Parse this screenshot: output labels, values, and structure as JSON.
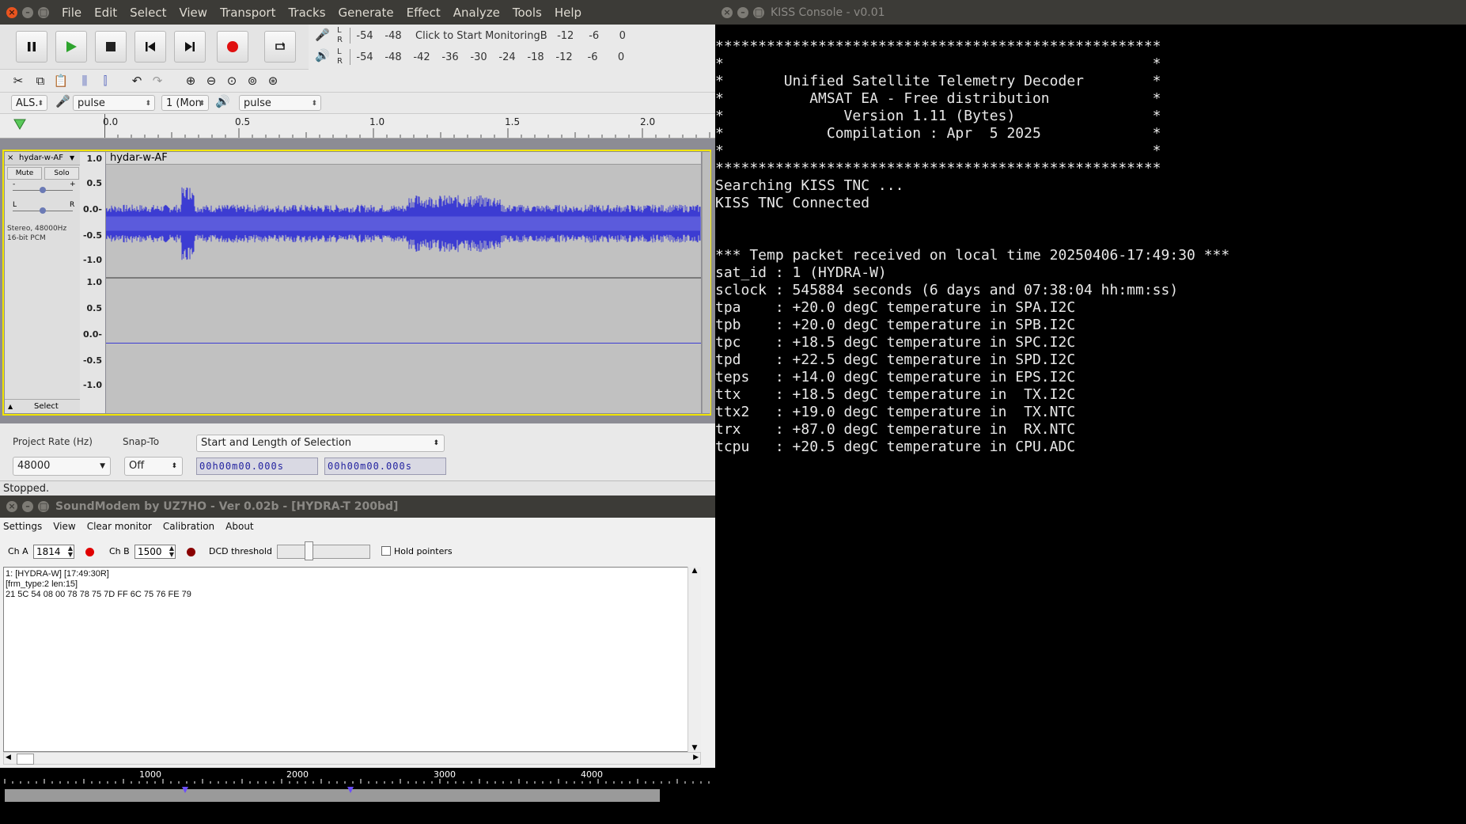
{
  "audacity": {
    "window_controls": [
      "close-icon",
      "minimize-icon",
      "maximize-icon"
    ],
    "menu": [
      "File",
      "Edit",
      "Select",
      "View",
      "Transport",
      "Tracks",
      "Generate",
      "Effect",
      "Analyze",
      "Tools",
      "Help"
    ],
    "record_meter": {
      "ticks": [
        "-54",
        "-48"
      ],
      "label": "Click to Start Monitoring",
      "ticks2": [
        "B",
        "-12",
        "-6",
        "0"
      ]
    },
    "play_meter": {
      "ticks": [
        "-54",
        "-48",
        "-42",
        "-36",
        "-30",
        "-24",
        "-18",
        "-12",
        "-6",
        "0"
      ]
    },
    "meter_lr": [
      "L",
      "R"
    ],
    "device": {
      "host": "ALS.",
      "rec_device": "pulse",
      "channels": "1 (Mon",
      "play_device": "pulse"
    },
    "ruler": {
      "labels": [
        "0.0",
        "0.5",
        "1.0",
        "1.5",
        "2.0"
      ]
    },
    "track": {
      "name": "hydar-w-AF",
      "clip_name": "hydar-w-AF",
      "mute": "Mute",
      "solo": "Solo",
      "gain_minus": "-",
      "gain_plus": "+",
      "pan_l": "L",
      "pan_r": "R",
      "info1": "Stereo, 48000Hz",
      "info2": "16-bit PCM",
      "select": "Select",
      "axis_top": [
        "1.0",
        "0.5",
        "0.0-",
        "-0.5",
        "-1.0"
      ],
      "axis_bottom": [
        "1.0",
        "0.5",
        "0.0-",
        "-0.5",
        "-1.0"
      ]
    },
    "selection": {
      "rate_label": "Project Rate (Hz)",
      "rate_value": "48000",
      "snap_label": "Snap-To",
      "snap_value": "Off",
      "format": "Start and Length of Selection",
      "start": "00h00m00.000s",
      "length": "00h00m00.000s"
    },
    "status": "Stopped."
  },
  "kiss": {
    "title": "KISS Console - v0.01",
    "lines": [
      "****************************************************",
      "*                                                  *",
      "*       Unified Satellite Telemetry Decoder        *",
      "*          AMSAT EA - Free distribution            *",
      "*              Version 1.11 (Bytes)                *",
      "*            Compilation : Apr  5 2025             *",
      "*                                                  *",
      "****************************************************",
      "Searching KISS TNC ...",
      "KISS TNC Connected",
      "",
      "",
      "*** Temp packet received on local time 20250406-17:49:30 ***",
      "sat_id : 1 (HYDRA-W)",
      "sclock : 545884 seconds (6 days and 07:38:04 hh:mm:ss)",
      "tpa    : +20.0 degC temperature in SPA.I2C",
      "tpb    : +20.0 degC temperature in SPB.I2C",
      "tpc    : +18.5 degC temperature in SPC.I2C",
      "tpd    : +22.5 degC temperature in SPD.I2C",
      "teps   : +14.0 degC temperature in EPS.I2C",
      "ttx    : +18.5 degC temperature in  TX.I2C",
      "ttx2   : +19.0 degC temperature in  TX.NTC",
      "trx    : +87.0 degC temperature in  RX.NTC",
      "tcpu   : +20.5 degC temperature in CPU.ADC"
    ]
  },
  "soundmodem": {
    "title": "SoundModem by UZ7HO - Ver 0.02b - [HYDRA-T 200bd]",
    "menu": [
      "Settings",
      "View",
      "Clear monitor",
      "Calibration",
      "About"
    ],
    "cha_label": "Ch A",
    "cha_value": "1814",
    "chb_label": "Ch B",
    "chb_value": "1500",
    "dcd_label": "DCD threshold",
    "hold_label": "Hold pointers",
    "monitor_lines": [
      "1: [HYDRA-W] [17:49:30R]",
      "[frm_type:2 len:15]",
      "21 5C 54 08 00 78 78 75 7D FF 6C 75 76 FE 79"
    ],
    "freq_labels": [
      "1000",
      "2000",
      "3000",
      "4000"
    ],
    "colors": {
      "led_a": "#e00000",
      "led_b": "#8a0000"
    }
  }
}
